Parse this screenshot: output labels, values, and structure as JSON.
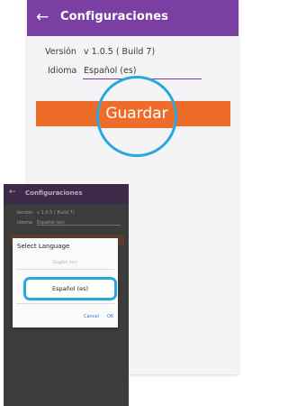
{
  "main": {
    "title": "Configuraciones",
    "back_icon": "arrow-left-icon",
    "version_label": "Versión",
    "version_value": "v 1.0.5 ( Build 7)",
    "language_label": "Idioma",
    "language_value": "Español (es)",
    "save_label": "Guardar"
  },
  "dialog_shot": {
    "title": "Configuraciones",
    "version_label": "Versión",
    "version_value": "v 1.0.5 ( Build 7)",
    "language_label": "Idioma",
    "language_value": "Español (es)",
    "dialog": {
      "title": "Select Language",
      "options": [
        "English (en)",
        "Español (es)"
      ],
      "cancel_label": "Cancel",
      "ok_label": "OK"
    }
  },
  "colors": {
    "appbar": "#7b3fa4",
    "accent": "#ee6c2a",
    "highlight": "#29a8de"
  }
}
